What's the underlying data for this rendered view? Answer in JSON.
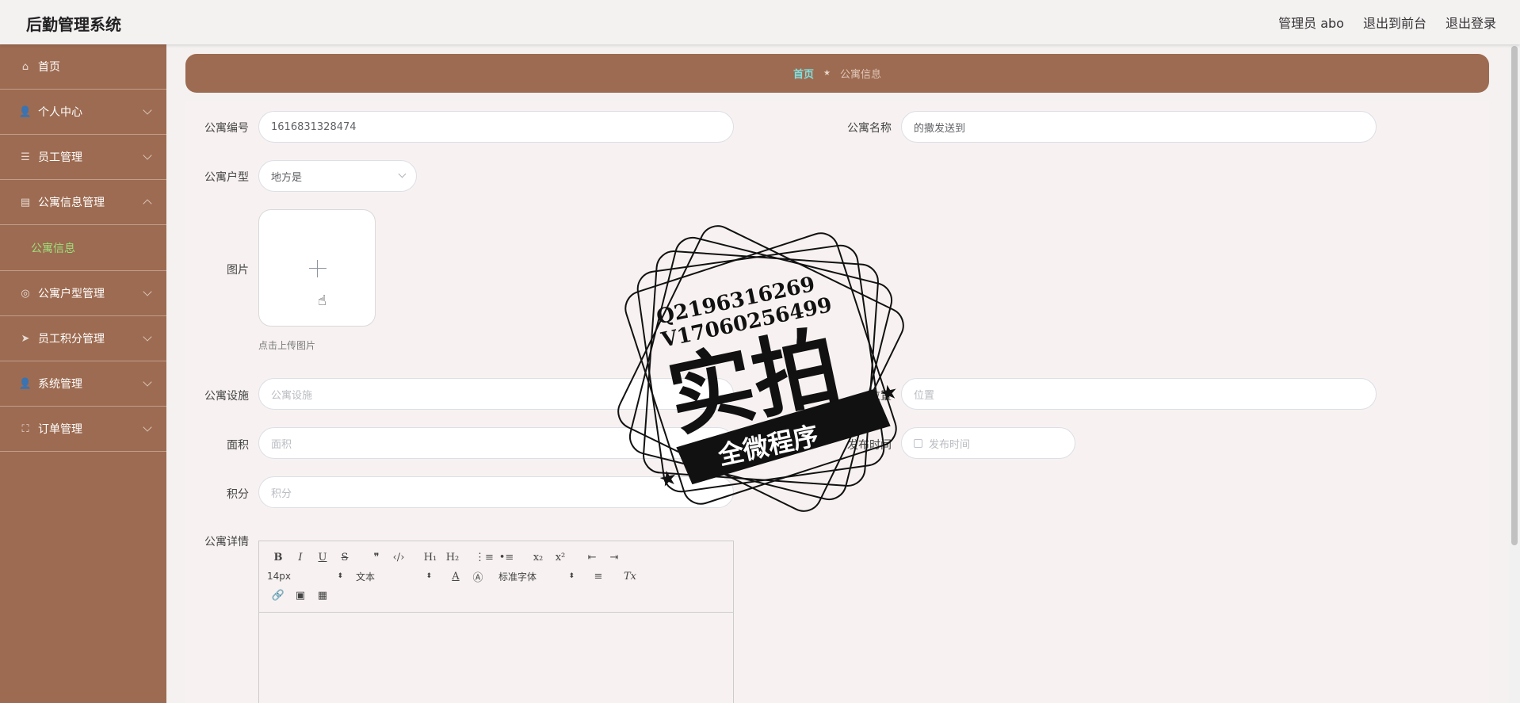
{
  "header": {
    "brand": "后勤管理系统",
    "user": "管理员 abo",
    "to_front": "退出到前台",
    "logout": "退出登录"
  },
  "sidebar": {
    "items": [
      {
        "label": "首页",
        "icon": "home-icon",
        "glyph": "⌂"
      },
      {
        "label": "个人中心",
        "icon": "user-icon",
        "glyph": "👤"
      },
      {
        "label": "员工管理",
        "icon": "list-icon",
        "glyph": "☰"
      },
      {
        "label": "公寓信息管理",
        "icon": "clipboard-icon",
        "glyph": "▤"
      },
      {
        "label": "公寓户型管理",
        "icon": "compass-icon",
        "glyph": "◎"
      },
      {
        "label": "员工积分管理",
        "icon": "send-icon",
        "glyph": "➤"
      },
      {
        "label": "系统管理",
        "icon": "user-icon",
        "glyph": "👤"
      },
      {
        "label": "订单管理",
        "icon": "frame-icon",
        "glyph": "⛶"
      }
    ],
    "active_sub": "公寓信息"
  },
  "breadcrumb": {
    "home": "首页",
    "sep": "★",
    "current": "公寓信息"
  },
  "form": {
    "apartment_no": {
      "label": "公寓编号",
      "value": "1616831328474"
    },
    "apartment_name": {
      "label": "公寓名称",
      "value": "的撒发送到"
    },
    "apartment_type": {
      "label": "公寓户型",
      "value": "地方是"
    },
    "image": {
      "label": "图片",
      "tip": "点击上传图片"
    },
    "facilities": {
      "label": "公寓设施",
      "placeholder": "公寓设施"
    },
    "location": {
      "label": "位置",
      "placeholder": "位置"
    },
    "area": {
      "label": "面积",
      "placeholder": "面积"
    },
    "publish_time": {
      "label": "发布时间",
      "placeholder": "发布时间"
    },
    "points": {
      "label": "积分",
      "placeholder": "积分"
    },
    "details": {
      "label": "公寓详情"
    }
  },
  "editor": {
    "size": "14px",
    "block": "文本",
    "font": "标准字体"
  },
  "watermark": {
    "line1": "Q2196316269",
    "line2": "V17060256499",
    "big": "实拍",
    "banner": "全微程序"
  }
}
